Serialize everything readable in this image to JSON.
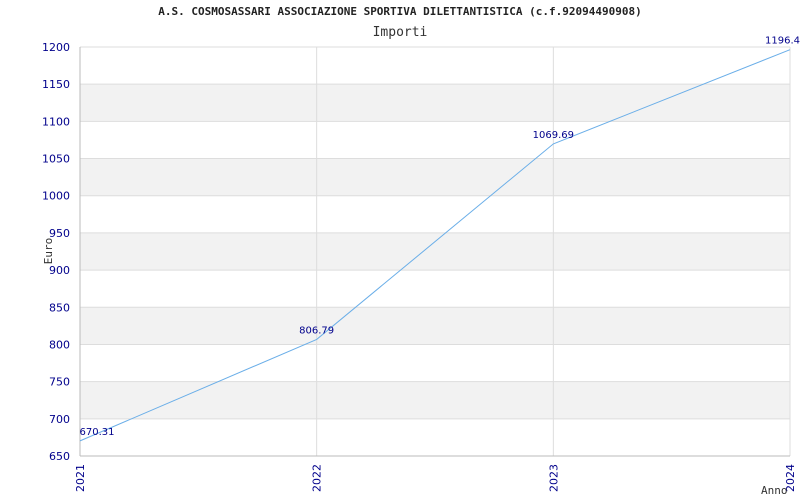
{
  "chart_data": {
    "type": "line",
    "title": "A.S. COSMOSASSARI ASSOCIAZIONE SPORTIVA DILETTANTISTICA (c.f.92094490908)",
    "subtitle": "Importi",
    "xlabel": "Anno",
    "ylabel": "Euro",
    "categories": [
      "2021",
      "2022",
      "2023",
      "2024"
    ],
    "values": [
      670.31,
      806.79,
      1069.69,
      1196.4
    ],
    "data_labels": [
      "670.31",
      "806.79",
      "1069.69",
      "1196.4"
    ],
    "yticks": [
      650,
      700,
      750,
      800,
      850,
      900,
      950,
      1000,
      1050,
      1100,
      1150,
      1200
    ],
    "ylim": [
      650,
      1200
    ],
    "grid": true,
    "line_color": "#6aaee8",
    "label_color": "#00008b",
    "band_color": "#f2f2f2"
  }
}
